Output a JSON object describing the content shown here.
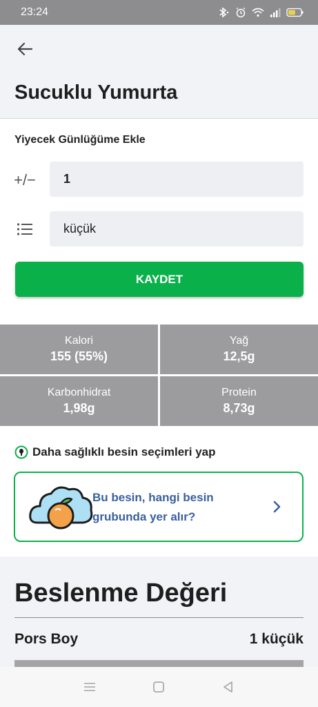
{
  "status": {
    "time": "23:24"
  },
  "header": {
    "title": "Sucuklu Yumurta"
  },
  "diary": {
    "title": "Yiyecek Günlüğüme Ekle",
    "qty_icon": "+/−",
    "quantity": "1",
    "unit": "küçük",
    "save_label": "KAYDET"
  },
  "nutrients": [
    {
      "label": "Kalori",
      "value": "155 (55%)"
    },
    {
      "label": "Yağ",
      "value": "12,5g"
    },
    {
      "label": "Karbonhidrat",
      "value": "1,98g"
    },
    {
      "label": "Protein",
      "value": "8,73g"
    }
  ],
  "tip": {
    "title": "Daha sağlıklı besin seçimleri yap",
    "card_text": "Bu besin, hangi besin grubunda yer alır?"
  },
  "nutrition": {
    "title": "Beslenme Değeri",
    "portion_label": "Pors Boy",
    "portion_value": "1 küçük"
  },
  "colors": {
    "accent": "#0ab14b",
    "link": "#3a5f9e",
    "tile": "#9c9c9e"
  }
}
